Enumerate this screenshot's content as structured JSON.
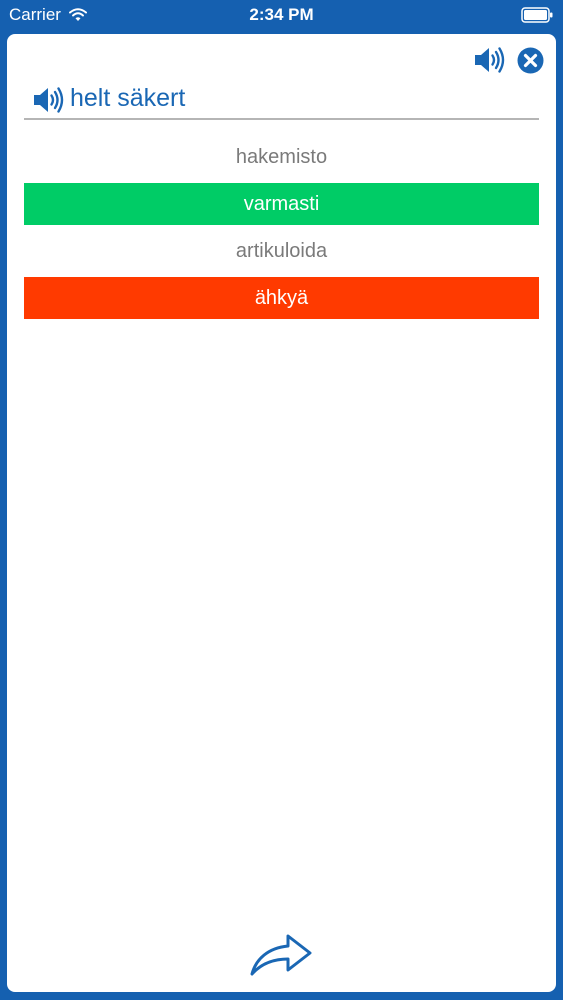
{
  "status_bar": {
    "carrier": "Carrier",
    "time": "2:34 PM"
  },
  "question": {
    "text": "helt säkert"
  },
  "answers": [
    {
      "label": "hakemisto",
      "state": "neutral"
    },
    {
      "label": "varmasti",
      "state": "correct"
    },
    {
      "label": "artikuloida",
      "state": "neutral"
    },
    {
      "label": "ähkyä",
      "state": "wrong"
    }
  ],
  "icons": {
    "top_speaker": "speaker-icon",
    "close": "close-icon",
    "question_speaker": "speaker-icon",
    "next": "forward-arrow-icon"
  },
  "colors": {
    "frame": "#1560b0",
    "accent": "#1a67b4",
    "correct": "#00cc66",
    "wrong": "#ff3a00"
  }
}
